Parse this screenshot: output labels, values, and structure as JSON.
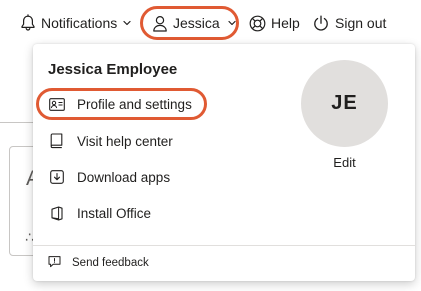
{
  "header": {
    "notifications_label": "Notifications",
    "user_label": "Jessica",
    "help_label": "Help",
    "signout_label": "Sign out",
    "highlight_color": "#e05a33"
  },
  "background": {
    "card_letter": "A",
    "card_glyph": "∴"
  },
  "dropdown": {
    "user_full_name": "Jessica Employee",
    "avatar_initials": "JE",
    "edit_label": "Edit",
    "items": [
      {
        "label": "Profile and settings",
        "icon": "id-card-icon"
      },
      {
        "label": "Visit help center",
        "icon": "book-icon"
      },
      {
        "label": "Download apps",
        "icon": "download-icon"
      },
      {
        "label": "Install Office",
        "icon": "office-icon"
      }
    ],
    "feedback_label": "Send feedback"
  }
}
